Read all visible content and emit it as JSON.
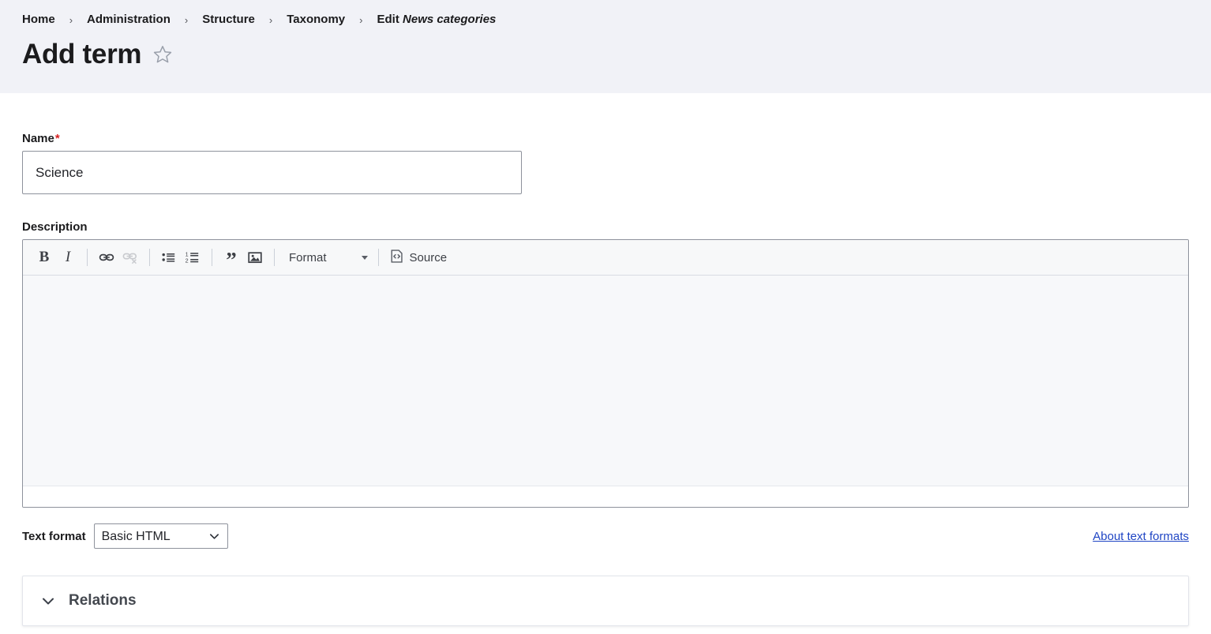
{
  "header": {
    "breadcrumb": [
      {
        "label": "Home",
        "emphasis": ""
      },
      {
        "label": "Administration",
        "emphasis": ""
      },
      {
        "label": "Structure",
        "emphasis": ""
      },
      {
        "label": "Taxonomy",
        "emphasis": ""
      },
      {
        "label": "Edit",
        "emphasis": "News categories"
      }
    ],
    "separator": "›",
    "title": "Add term",
    "star_icon": "star-outline-icon",
    "background_color": "#f1f2f7"
  },
  "form": {
    "name": {
      "label": "Name",
      "required_mark": "*",
      "value": "Science",
      "placeholder": ""
    },
    "description": {
      "label": "Description",
      "value": "",
      "placeholder": ""
    },
    "editor": {
      "buttons": [
        {
          "name": "bold-icon",
          "label": "B",
          "disabled": false
        },
        {
          "name": "italic-icon",
          "label": "I",
          "disabled": false
        },
        {
          "name": "link-icon",
          "label": "Link",
          "disabled": false
        },
        {
          "name": "unlink-icon",
          "label": "Unlink",
          "disabled": true
        },
        {
          "name": "bulleted-list-icon",
          "label": "Bulleted list",
          "disabled": false
        },
        {
          "name": "numbered-list-icon",
          "label": "Numbered list",
          "disabled": false
        },
        {
          "name": "blockquote-icon",
          "label": "Block quote",
          "disabled": false
        },
        {
          "name": "image-icon",
          "label": "Image",
          "disabled": false
        }
      ],
      "format_dropdown": {
        "label": "Format",
        "caret_icon": "caret-down-icon"
      },
      "source": {
        "label": "Source",
        "icon": "source-code-icon"
      }
    },
    "text_format": {
      "label": "Text format",
      "selected": "Basic HTML",
      "options": [
        "Basic HTML"
      ],
      "chevron_icon": "chevron-down-icon",
      "about_link": "About text formats",
      "link_color": "#1f45c4"
    },
    "relations": {
      "title": "Relations",
      "chevron_icon": "chevron-down-icon",
      "expanded": false
    }
  }
}
